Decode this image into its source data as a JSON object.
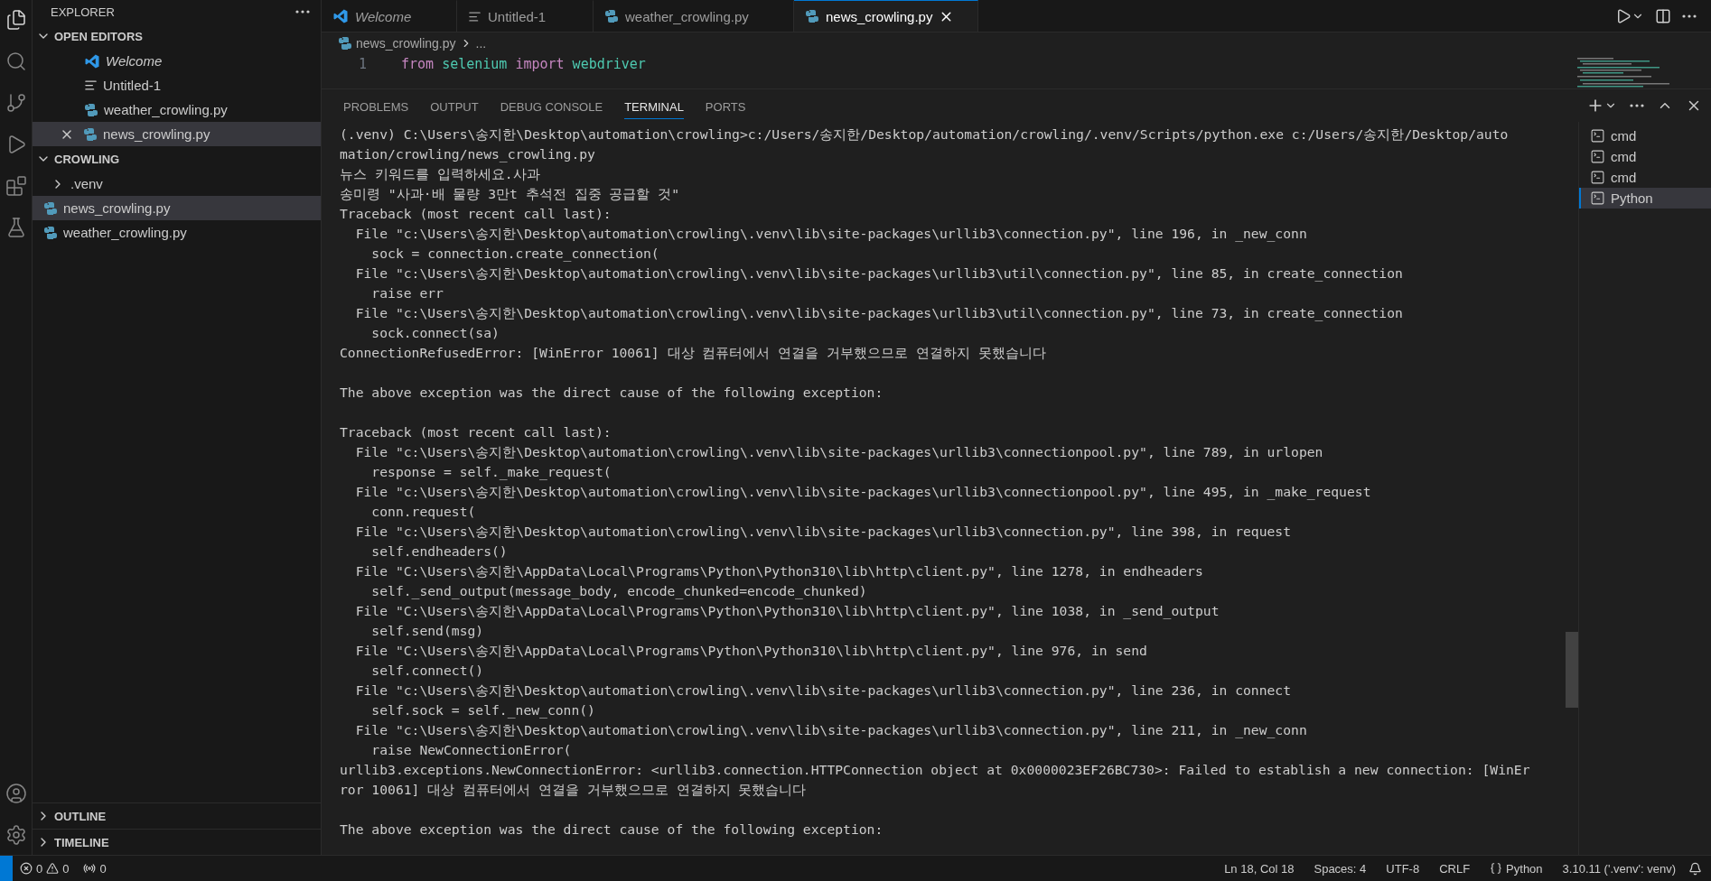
{
  "activity_bar": {
    "items": [
      {
        "kind": "explorer",
        "selected": true
      },
      {
        "kind": "search",
        "selected": false
      },
      {
        "kind": "source-control",
        "selected": false
      },
      {
        "kind": "run",
        "selected": false
      },
      {
        "kind": "extensions",
        "selected": false
      },
      {
        "kind": "testing",
        "selected": false
      }
    ],
    "bottom": [
      {
        "kind": "account"
      },
      {
        "kind": "settings"
      }
    ]
  },
  "sidebar": {
    "title": "EXPLORER",
    "sections": [
      {
        "title": "OPEN EDITORS",
        "expanded": true,
        "items": [
          {
            "label": "Welcome",
            "kind": "welcome",
            "preview": true,
            "selected": false
          },
          {
            "label": "Untitled-1",
            "kind": "text",
            "preview": false,
            "selected": false
          },
          {
            "label": "weather_crowling.py",
            "kind": "python",
            "preview": false,
            "selected": false
          },
          {
            "label": "news_crowling.py",
            "kind": "python",
            "preview": false,
            "selected": true
          }
        ]
      },
      {
        "title": "CROWLING",
        "expanded": true,
        "items": [
          {
            "label": ".venv",
            "kind": "folder",
            "preview": false,
            "selected": false
          },
          {
            "label": "news_crowling.py",
            "kind": "python",
            "preview": false,
            "selected": true
          },
          {
            "label": "weather_crowling.py",
            "kind": "python",
            "preview": false,
            "selected": false
          }
        ]
      }
    ],
    "footer_sections": [
      {
        "title": "OUTLINE",
        "expanded": false
      },
      {
        "title": "TIMELINE",
        "expanded": false
      }
    ]
  },
  "editor": {
    "tabs": [
      {
        "label": "Welcome",
        "kind": "welcome",
        "preview": true,
        "selected": false
      },
      {
        "label": "Untitled-1",
        "kind": "text",
        "preview": false,
        "selected": false
      },
      {
        "label": "weather_crowling.py",
        "kind": "python",
        "preview": false,
        "selected": false
      },
      {
        "label": "news_crowling.py",
        "kind": "python",
        "preview": false,
        "selected": true
      }
    ],
    "breadcrumb": [
      "news_crowling.py",
      "..."
    ],
    "code_lines": [
      {
        "number": "1",
        "tokens": [
          {
            "text": "from",
            "kind": "keyword"
          },
          {
            "text": "selenium",
            "kind": "module"
          },
          {
            "text": "import",
            "kind": "keyword"
          },
          {
            "text": "webdriver",
            "kind": "module"
          }
        ]
      }
    ]
  },
  "panel": {
    "tabs": [
      {
        "label": "PROBLEMS",
        "selected": false
      },
      {
        "label": "OUTPUT",
        "selected": false
      },
      {
        "label": "DEBUG CONSOLE",
        "selected": false
      },
      {
        "label": "TERMINAL",
        "selected": true
      },
      {
        "label": "PORTS",
        "selected": false
      }
    ],
    "terminal_blocks": [
      [
        "(.venv) C:\\Users\\송지한\\Desktop\\automation\\crowling>c:/Users/송지한/Desktop/automation/crowling/.venv/Scripts/python.exe c:/Users/송지한/Desktop/auto",
        "mation/crowling/news_crowling.py",
        "뉴스 키워드를 입력하세요.사과",
        "송미령 \"사과·배 물량 3만t 추석전 집중 공급할 것\"",
        "Traceback (most recent call last):",
        "  File \"c:\\Users\\송지한\\Desktop\\automation\\crowling\\.venv\\lib\\site-packages\\urllib3\\connection.py\", line 196, in _new_conn",
        "    sock = connection.create_connection(",
        "  File \"c:\\Users\\송지한\\Desktop\\automation\\crowling\\.venv\\lib\\site-packages\\urllib3\\util\\connection.py\", line 85, in create_connection",
        "    raise err",
        "  File \"c:\\Users\\송지한\\Desktop\\automation\\crowling\\.venv\\lib\\site-packages\\urllib3\\util\\connection.py\", line 73, in create_connection",
        "    sock.connect(sa)",
        "ConnectionRefusedError: [WinError 10061] 대상 컴퓨터에서 연결을 거부했으므로 연결하지 못했습니다"
      ],
      [
        "The above exception was the direct cause of the following exception:"
      ],
      [
        "Traceback (most recent call last):",
        "  File \"c:\\Users\\송지한\\Desktop\\automation\\crowling\\.venv\\lib\\site-packages\\urllib3\\connectionpool.py\", line 789, in urlopen",
        "    response = self._make_request(",
        "  File \"c:\\Users\\송지한\\Desktop\\automation\\crowling\\.venv\\lib\\site-packages\\urllib3\\connectionpool.py\", line 495, in _make_request",
        "    conn.request(",
        "  File \"c:\\Users\\송지한\\Desktop\\automation\\crowling\\.venv\\lib\\site-packages\\urllib3\\connection.py\", line 398, in request",
        "    self.endheaders()",
        "  File \"C:\\Users\\송지한\\AppData\\Local\\Programs\\Python\\Python310\\lib\\http\\client.py\", line 1278, in endheaders",
        "    self._send_output(message_body, encode_chunked=encode_chunked)",
        "  File \"C:\\Users\\송지한\\AppData\\Local\\Programs\\Python\\Python310\\lib\\http\\client.py\", line 1038, in _send_output",
        "    self.send(msg)",
        "  File \"C:\\Users\\송지한\\AppData\\Local\\Programs\\Python\\Python310\\lib\\http\\client.py\", line 976, in send",
        "    self.connect()",
        "  File \"c:\\Users\\송지한\\Desktop\\automation\\crowling\\.venv\\lib\\site-packages\\urllib3\\connection.py\", line 236, in connect",
        "    self.sock = self._new_conn()",
        "  File \"c:\\Users\\송지한\\Desktop\\automation\\crowling\\.venv\\lib\\site-packages\\urllib3\\connection.py\", line 211, in _new_conn",
        "    raise NewConnectionError(",
        "urllib3.exceptions.NewConnectionError: <urllib3.connection.HTTPConnection object at 0x0000023EF26BC730>: Failed to establish a new connection: [WinEr",
        "ror 10061] 대상 컴퓨터에서 연결을 거부했으므로 연결하지 못했습니다"
      ],
      [
        "The above exception was the direct cause of the following exception:"
      ]
    ],
    "sessions": [
      {
        "label": "cmd",
        "selected": false
      },
      {
        "label": "cmd",
        "selected": false
      },
      {
        "label": "cmd",
        "selected": false
      },
      {
        "label": "Python",
        "selected": true
      }
    ]
  },
  "status_bar": {
    "errors": "0",
    "warnings": "0",
    "ports": "0",
    "right": [
      {
        "text": "Ln 18, Col 18",
        "kind": "plain"
      },
      {
        "text": "Spaces: 4",
        "kind": "plain"
      },
      {
        "text": "UTF-8",
        "kind": "plain"
      },
      {
        "text": "CRLF",
        "kind": "plain"
      },
      {
        "text": "Python",
        "kind": "language"
      },
      {
        "text": "3.10.11 ('.venv': venv)",
        "kind": "plain"
      }
    ]
  }
}
